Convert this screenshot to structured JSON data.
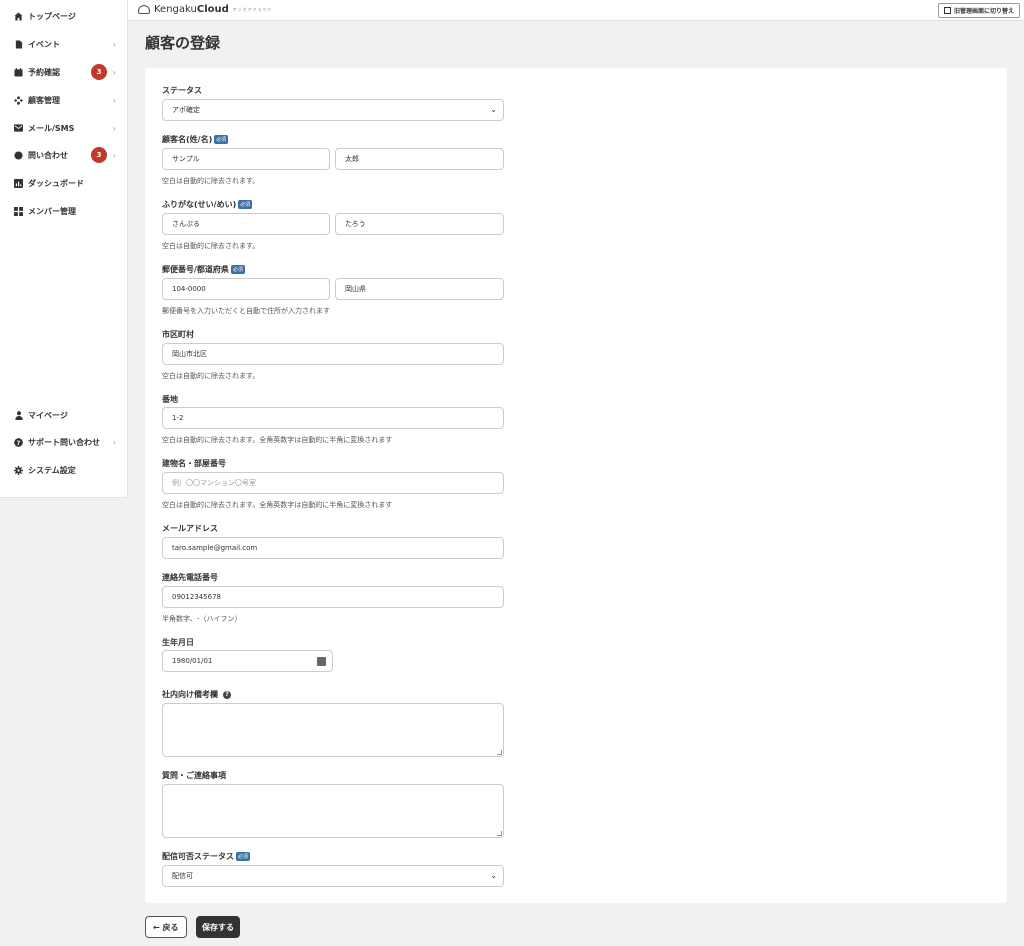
{
  "sidebar": {
    "items": [
      {
        "label": "トップページ",
        "icon": "home-icon",
        "badge": "",
        "chevron": false
      },
      {
        "label": "イベント",
        "icon": "document-icon",
        "badge": "",
        "chevron": true
      },
      {
        "label": "予約確認",
        "icon": "calendar-icon",
        "badge": "3",
        "chevron": true
      },
      {
        "label": "顧客管理",
        "icon": "people-icon",
        "badge": "",
        "chevron": true
      },
      {
        "label": "メール/SMS",
        "icon": "envelope-icon",
        "badge": "",
        "chevron": true
      },
      {
        "label": "問い合わせ",
        "icon": "chat-icon",
        "badge": "3",
        "chevron": true
      },
      {
        "label": "ダッシュボード",
        "icon": "chart-icon",
        "badge": "",
        "chevron": false
      },
      {
        "label": "メンバー管理",
        "icon": "grid-icon",
        "badge": "",
        "chevron": false
      }
    ],
    "bottom_items": [
      {
        "label": "マイページ",
        "icon": "user-icon",
        "chevron": false
      },
      {
        "label": "サポート問い合わせ",
        "icon": "question-icon",
        "chevron": true
      },
      {
        "label": "システム設定",
        "icon": "gear-icon",
        "chevron": false
      }
    ],
    "chevron_glyph": "›"
  },
  "header": {
    "logo_text_regular": "Kengaku",
    "logo_text_bold": "Cloud",
    "logo_sub": "ケンガククラウド",
    "switch_label": "旧管理画面に切り替え"
  },
  "page": {
    "title": "顧客の登録"
  },
  "form": {
    "status": {
      "label": "ステータス",
      "value": "アポ確定"
    },
    "name": {
      "label": "顧客名(姓/名)",
      "required": "必須",
      "last": "サンプル",
      "first": "太郎",
      "hint": "空白は自動的に除去されます。"
    },
    "kana": {
      "label": "ふりがな(せい/めい)",
      "required": "必須",
      "last": "さんぷる",
      "first": "たろう",
      "hint": "空白は自動的に除去されます。"
    },
    "postal": {
      "label": "郵便番号/都道府県",
      "required": "必須",
      "zip": "104-0000",
      "pref": "岡山県",
      "hint": "郵便番号を入力いただくと自動で住所が入力されます"
    },
    "city": {
      "label": "市区町村",
      "value": "岡山市北区",
      "hint": "空白は自動的に除去されます。"
    },
    "address": {
      "label": "番地",
      "value": "1-2",
      "hint": "空白は自動的に除去されます。全角英数字は自動的に半角に変換されます"
    },
    "building": {
      "label": "建物名・部屋番号",
      "placeholder": "例）〇〇マンション〇号室",
      "hint": "空白は自動的に除去されます。全角英数字は自動的に半角に変換されます"
    },
    "email": {
      "label": "メールアドレス",
      "value": "taro.sample@gmail.com"
    },
    "phone": {
      "label": "連絡先電話番号",
      "value": "09012345678",
      "hint": "半角数字、-（ハイフン）"
    },
    "birthday": {
      "label": "生年月日",
      "value": "1980/01/01"
    },
    "internal_note": {
      "label": "社内向け備考欄"
    },
    "questions": {
      "label": "質問・ご連絡事項"
    },
    "delivery": {
      "label": "配信可否ステータス",
      "required": "必須",
      "value": "配信可"
    }
  },
  "actions": {
    "back_label": "← 戻る",
    "save_label": "保存する"
  }
}
